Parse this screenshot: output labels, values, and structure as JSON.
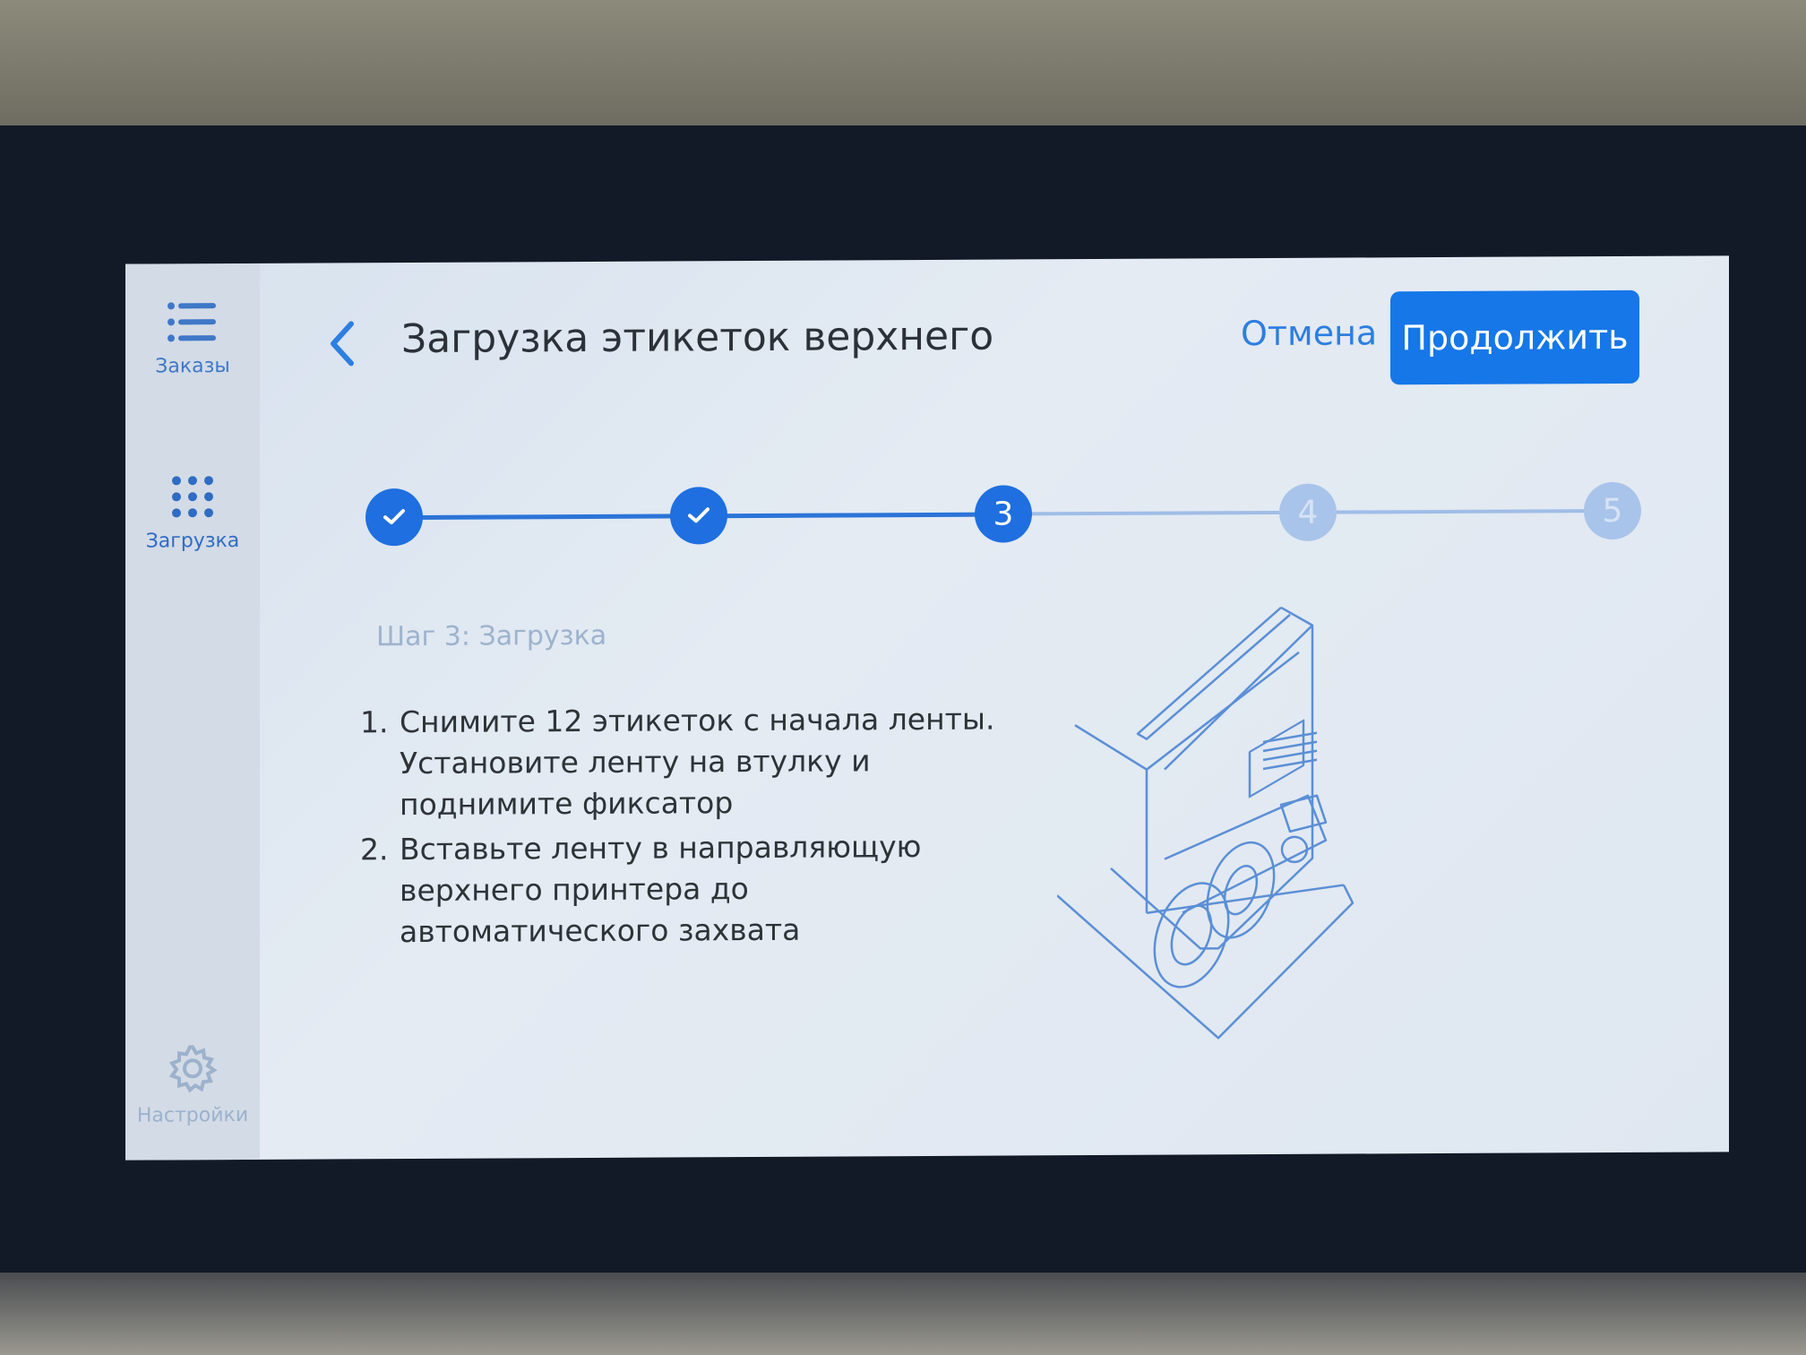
{
  "sidebar": {
    "items": [
      {
        "label": "Заказы",
        "icon": "list-icon"
      },
      {
        "label": "Загрузка",
        "icon": "grid-icon"
      },
      {
        "label": "Настройки",
        "icon": "gear-icon"
      }
    ]
  },
  "header": {
    "title": "Загрузка этикеток верхнего",
    "cancel_label": "Отмена",
    "continue_label": "Продолжить"
  },
  "stepper": {
    "current": 3,
    "steps": [
      {
        "label": "",
        "state": "done"
      },
      {
        "label": "",
        "state": "done"
      },
      {
        "label": "3",
        "state": "current"
      },
      {
        "label": "4",
        "state": "todo"
      },
      {
        "label": "5",
        "state": "todo"
      }
    ]
  },
  "content": {
    "step_title": "Шаг 3: Загрузка",
    "instructions": [
      {
        "num": "1.",
        "lines": [
          "Снимите 12 этикеток с начала ленты.",
          "Установите ленту на втулку и",
          "поднимите фиксатор"
        ]
      },
      {
        "num": "2.",
        "lines": [
          "Вставьте ленту в направляющую",
          "верхнего принтера до",
          "автоматического захвата"
        ]
      }
    ]
  },
  "colors": {
    "accent": "#1677e8",
    "step_done": "#1f6fe0",
    "step_todo": "#a9c4ea",
    "text": "#2e3338"
  }
}
